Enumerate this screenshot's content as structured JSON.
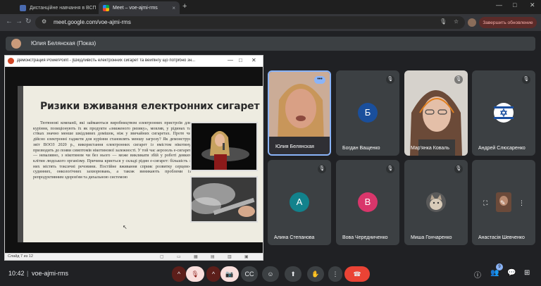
{
  "browser": {
    "tabs": [
      {
        "label": "Дистанційне навчання в ВСП",
        "active": false,
        "close": "×"
      },
      {
        "label": "Meet – voe-ajmi-rms",
        "active": true,
        "close": "×"
      }
    ],
    "new_tab": "+",
    "window_controls": {
      "minimize": "—",
      "maximize": "□",
      "close": "✕"
    },
    "url": "meet.google.com/voe-ajmi-rms",
    "update_label": "Завершить обновление",
    "nav": {
      "back": "←",
      "forward": "→",
      "reload": "↻"
    }
  },
  "meeting": {
    "presenter_label": "Юлия Белянская (Показ)",
    "code": "voe-ajmi-rms",
    "time": "10:42",
    "participants_count": "9"
  },
  "presentation": {
    "window_title": "Демонстрация PowerPoint - [Шкідливість електронних сигарет та вейпінгу що потрібно зн...",
    "slide_title": "Ризики вживання електронних сигарет",
    "slide_body": "Тютюнові компанії, які займаються виробництвом електронних пристроїв для куріння, позиціонують їх як продукти «зниженого ризику», мовляв, у рідинах та стіках значно менше шкідливих домішок, ніж у звичайних сигаретах. Проте чи дійсно електронні гаджети для куріння становлять меншу загрозу? Як демонструє звіт ВООЗ 2020 р., використання електронних сигарет із вмістом нікотину призводить до появи симптомів нікотинової залежності. У той час аерозоль е-сигарет — невалявно, з нікотином чи без нього — може викликати збій у роботі деяких клітин людського організму. Причина криється у складі рідин е-сигарет: більшість з них містять токсичні речовини. Постійне вживання сприяє розвитку серцево-судинних, онкологічних захворювань, а також виникають проблеми із репродуктивним здоров'ям та дихальною системою",
    "slide_status": "Слайд 7 из 12"
  },
  "tiles": [
    {
      "name": "Юлия Белянская",
      "type": "video",
      "speaking": true,
      "more": "•••"
    },
    {
      "name": "Богдан Ващенко",
      "type": "initial",
      "initial": "Б",
      "color": "#1a4f9c"
    },
    {
      "name": "Мар'янка Коваль",
      "type": "video"
    },
    {
      "name": "Андрей Слюсаренко",
      "type": "flag"
    },
    {
      "name": "Алина Степанова",
      "type": "initial",
      "initial": "А",
      "color": "#12828c"
    },
    {
      "name": "Вова Чередниченко",
      "type": "initial",
      "initial": "В",
      "color": "#d9366b"
    },
    {
      "name": "Миша Гончаренко",
      "type": "cat"
    },
    {
      "name": "Анастасія Шевченко",
      "type": "self"
    }
  ],
  "controls": {
    "caret": "^",
    "mic": "🎙",
    "cam": "📷",
    "captions": "CC",
    "emoji": "☺",
    "present": "⬆",
    "hand": "✋",
    "more": "⋮",
    "leave": "☎",
    "info": "ⓘ",
    "people": "👥",
    "chat": "💬",
    "activities": "⊞"
  },
  "colors": {
    "accent": "#8ab4f8",
    "leave": "#ea4335",
    "tile": "#3c4043"
  }
}
